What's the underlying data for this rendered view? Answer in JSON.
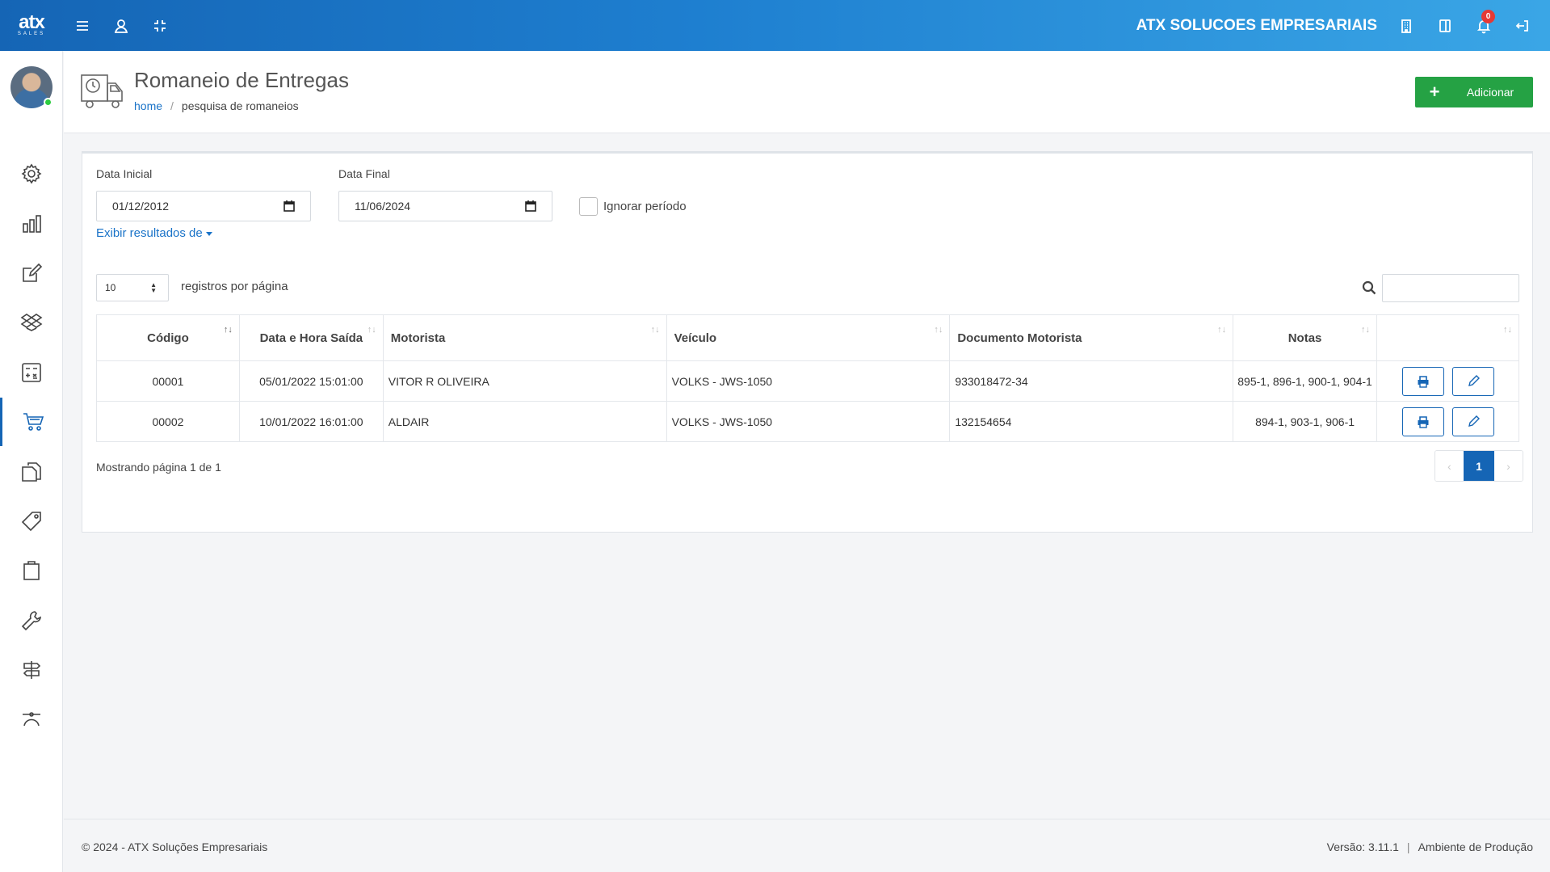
{
  "topbar": {
    "logo_word": "atx",
    "logo_sub": "SALES",
    "company": "ATX SOLUCOES EMPRESARIAIS",
    "notification_count": "0"
  },
  "sidebar": {
    "items": [
      {
        "name": "gear-icon"
      },
      {
        "name": "bar-chart-icon"
      },
      {
        "name": "edit-icon"
      },
      {
        "name": "dropbox-icon"
      },
      {
        "name": "calculator-icon"
      },
      {
        "name": "cart-icon",
        "active": true
      },
      {
        "name": "documents-icon"
      },
      {
        "name": "tag-icon"
      },
      {
        "name": "clipboard-icon"
      },
      {
        "name": "wrench-icon"
      },
      {
        "name": "signpost-icon"
      },
      {
        "name": "bezier-icon"
      }
    ]
  },
  "header": {
    "title": "Romaneio de Entregas",
    "breadcrumb_home": "home",
    "breadcrumb_sep": "/",
    "breadcrumb_current": "pesquisa de romaneios",
    "add_label": "Adicionar"
  },
  "filters": {
    "data_inicial_label": "Data Inicial",
    "data_inicial_value": "01/12/2012",
    "data_final_label": "Data Final",
    "data_final_value": "11/06/2024",
    "ignorar_label": "Ignorar período",
    "exibir_label": "Exibir resultados de"
  },
  "table_controls": {
    "per_page_value": "10",
    "per_page_label": "registros por página"
  },
  "table": {
    "headers": [
      "Código",
      "Data e Hora Saída",
      "Motorista",
      "Veículo",
      "Documento Motorista",
      "Notas",
      ""
    ],
    "rows": [
      {
        "codigo": "00001",
        "data": "05/01/2022 15:01:00",
        "motorista": "VITOR R OLIVEIRA",
        "veiculo": "VOLKS - JWS-1050",
        "documento": "933018472-34",
        "notas": "895-1, 896-1, 900-1, 904-1"
      },
      {
        "codigo": "00002",
        "data": "10/01/2022 16:01:00",
        "motorista": "ALDAIR",
        "veiculo": "VOLKS - JWS-1050",
        "documento": "132154654",
        "notas": "894-1, 903-1, 906-1"
      }
    ]
  },
  "pagination": {
    "showing": "Mostrando página 1 de 1",
    "current_page": "1"
  },
  "footer": {
    "copyright": "© 2024 - ATX Soluções Empresariais",
    "version": "Versão: 3.11.1",
    "separator": "|",
    "environment": "Ambiente de Produção"
  },
  "colors": {
    "primary": "#1565b5",
    "success": "#25a244",
    "danger": "#e53935"
  }
}
